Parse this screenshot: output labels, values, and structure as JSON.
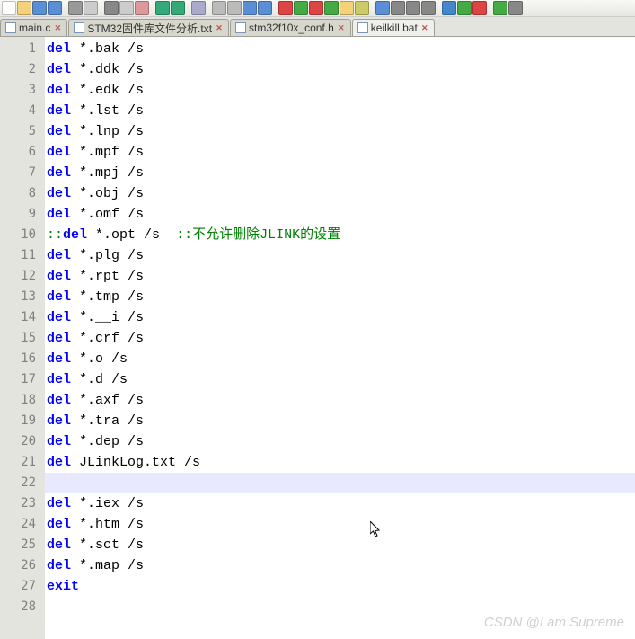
{
  "tabs": [
    {
      "label": "main.c",
      "active": false
    },
    {
      "label": "STM32固件库文件分析.txt",
      "active": false
    },
    {
      "label": "stm32f10x_conf.h",
      "active": false
    },
    {
      "label": "keilkill.bat",
      "active": true
    }
  ],
  "code_lines": [
    {
      "n": 1,
      "kw": "del",
      "rest": " *.bak /s"
    },
    {
      "n": 2,
      "kw": "del",
      "rest": " *.ddk /s"
    },
    {
      "n": 3,
      "kw": "del",
      "rest": " *.edk /s"
    },
    {
      "n": 4,
      "kw": "del",
      "rest": " *.lst /s"
    },
    {
      "n": 5,
      "kw": "del",
      "rest": " *.lnp /s"
    },
    {
      "n": 6,
      "kw": "del",
      "rest": " *.mpf /s"
    },
    {
      "n": 7,
      "kw": "del",
      "rest": " *.mpj /s"
    },
    {
      "n": 8,
      "kw": "del",
      "rest": " *.obj /s"
    },
    {
      "n": 9,
      "kw": "del",
      "rest": " *.omf /s"
    },
    {
      "n": 10,
      "cmt_pre": "::",
      "kw": "del",
      "rest": " *.opt /s  ",
      "cmt_post": "::不允许删除JLINK的设置"
    },
    {
      "n": 11,
      "kw": "del",
      "rest": " *.plg /s"
    },
    {
      "n": 12,
      "kw": "del",
      "rest": " *.rpt /s"
    },
    {
      "n": 13,
      "kw": "del",
      "rest": " *.tmp /s"
    },
    {
      "n": 14,
      "kw": "del",
      "rest": " *.__i /s"
    },
    {
      "n": 15,
      "kw": "del",
      "rest": " *.crf /s"
    },
    {
      "n": 16,
      "kw": "del",
      "rest": " *.o /s"
    },
    {
      "n": 17,
      "kw": "del",
      "rest": " *.d /s"
    },
    {
      "n": 18,
      "kw": "del",
      "rest": " *.axf /s"
    },
    {
      "n": 19,
      "kw": "del",
      "rest": " *.tra /s"
    },
    {
      "n": 20,
      "kw": "del",
      "rest": " *.dep /s"
    },
    {
      "n": 21,
      "kw": "del",
      "rest": " JLinkLog.txt /s"
    },
    {
      "n": 22,
      "current": true
    },
    {
      "n": 23,
      "kw": "del",
      "rest": " *.iex /s"
    },
    {
      "n": 24,
      "kw": "del",
      "rest": " *.htm /s"
    },
    {
      "n": 25,
      "kw": "del",
      "rest": " *.sct /s"
    },
    {
      "n": 26,
      "kw": "del",
      "rest": " *.map /s"
    },
    {
      "n": 27,
      "kw": "exit",
      "rest": ""
    },
    {
      "n": 28
    }
  ],
  "watermark": "CSDN @I am Supreme",
  "toolbar_icons": [
    "new-file",
    "open",
    "save",
    "save-all",
    "sep",
    "print",
    "preview",
    "sep",
    "cut",
    "copy",
    "paste",
    "sep",
    "undo",
    "redo",
    "sep",
    "find",
    "sep",
    "zoom-in",
    "zoom-out",
    "nav-back",
    "nav-fwd",
    "sep",
    "tool-red",
    "tool-green",
    "tool-red2",
    "tool-green2",
    "tool-folder",
    "tool-pin",
    "sep",
    "list",
    "hex",
    "toggle",
    "wrap",
    "sep",
    "marker-blue",
    "marker-green",
    "marker-red",
    "sep",
    "run",
    "gear"
  ]
}
